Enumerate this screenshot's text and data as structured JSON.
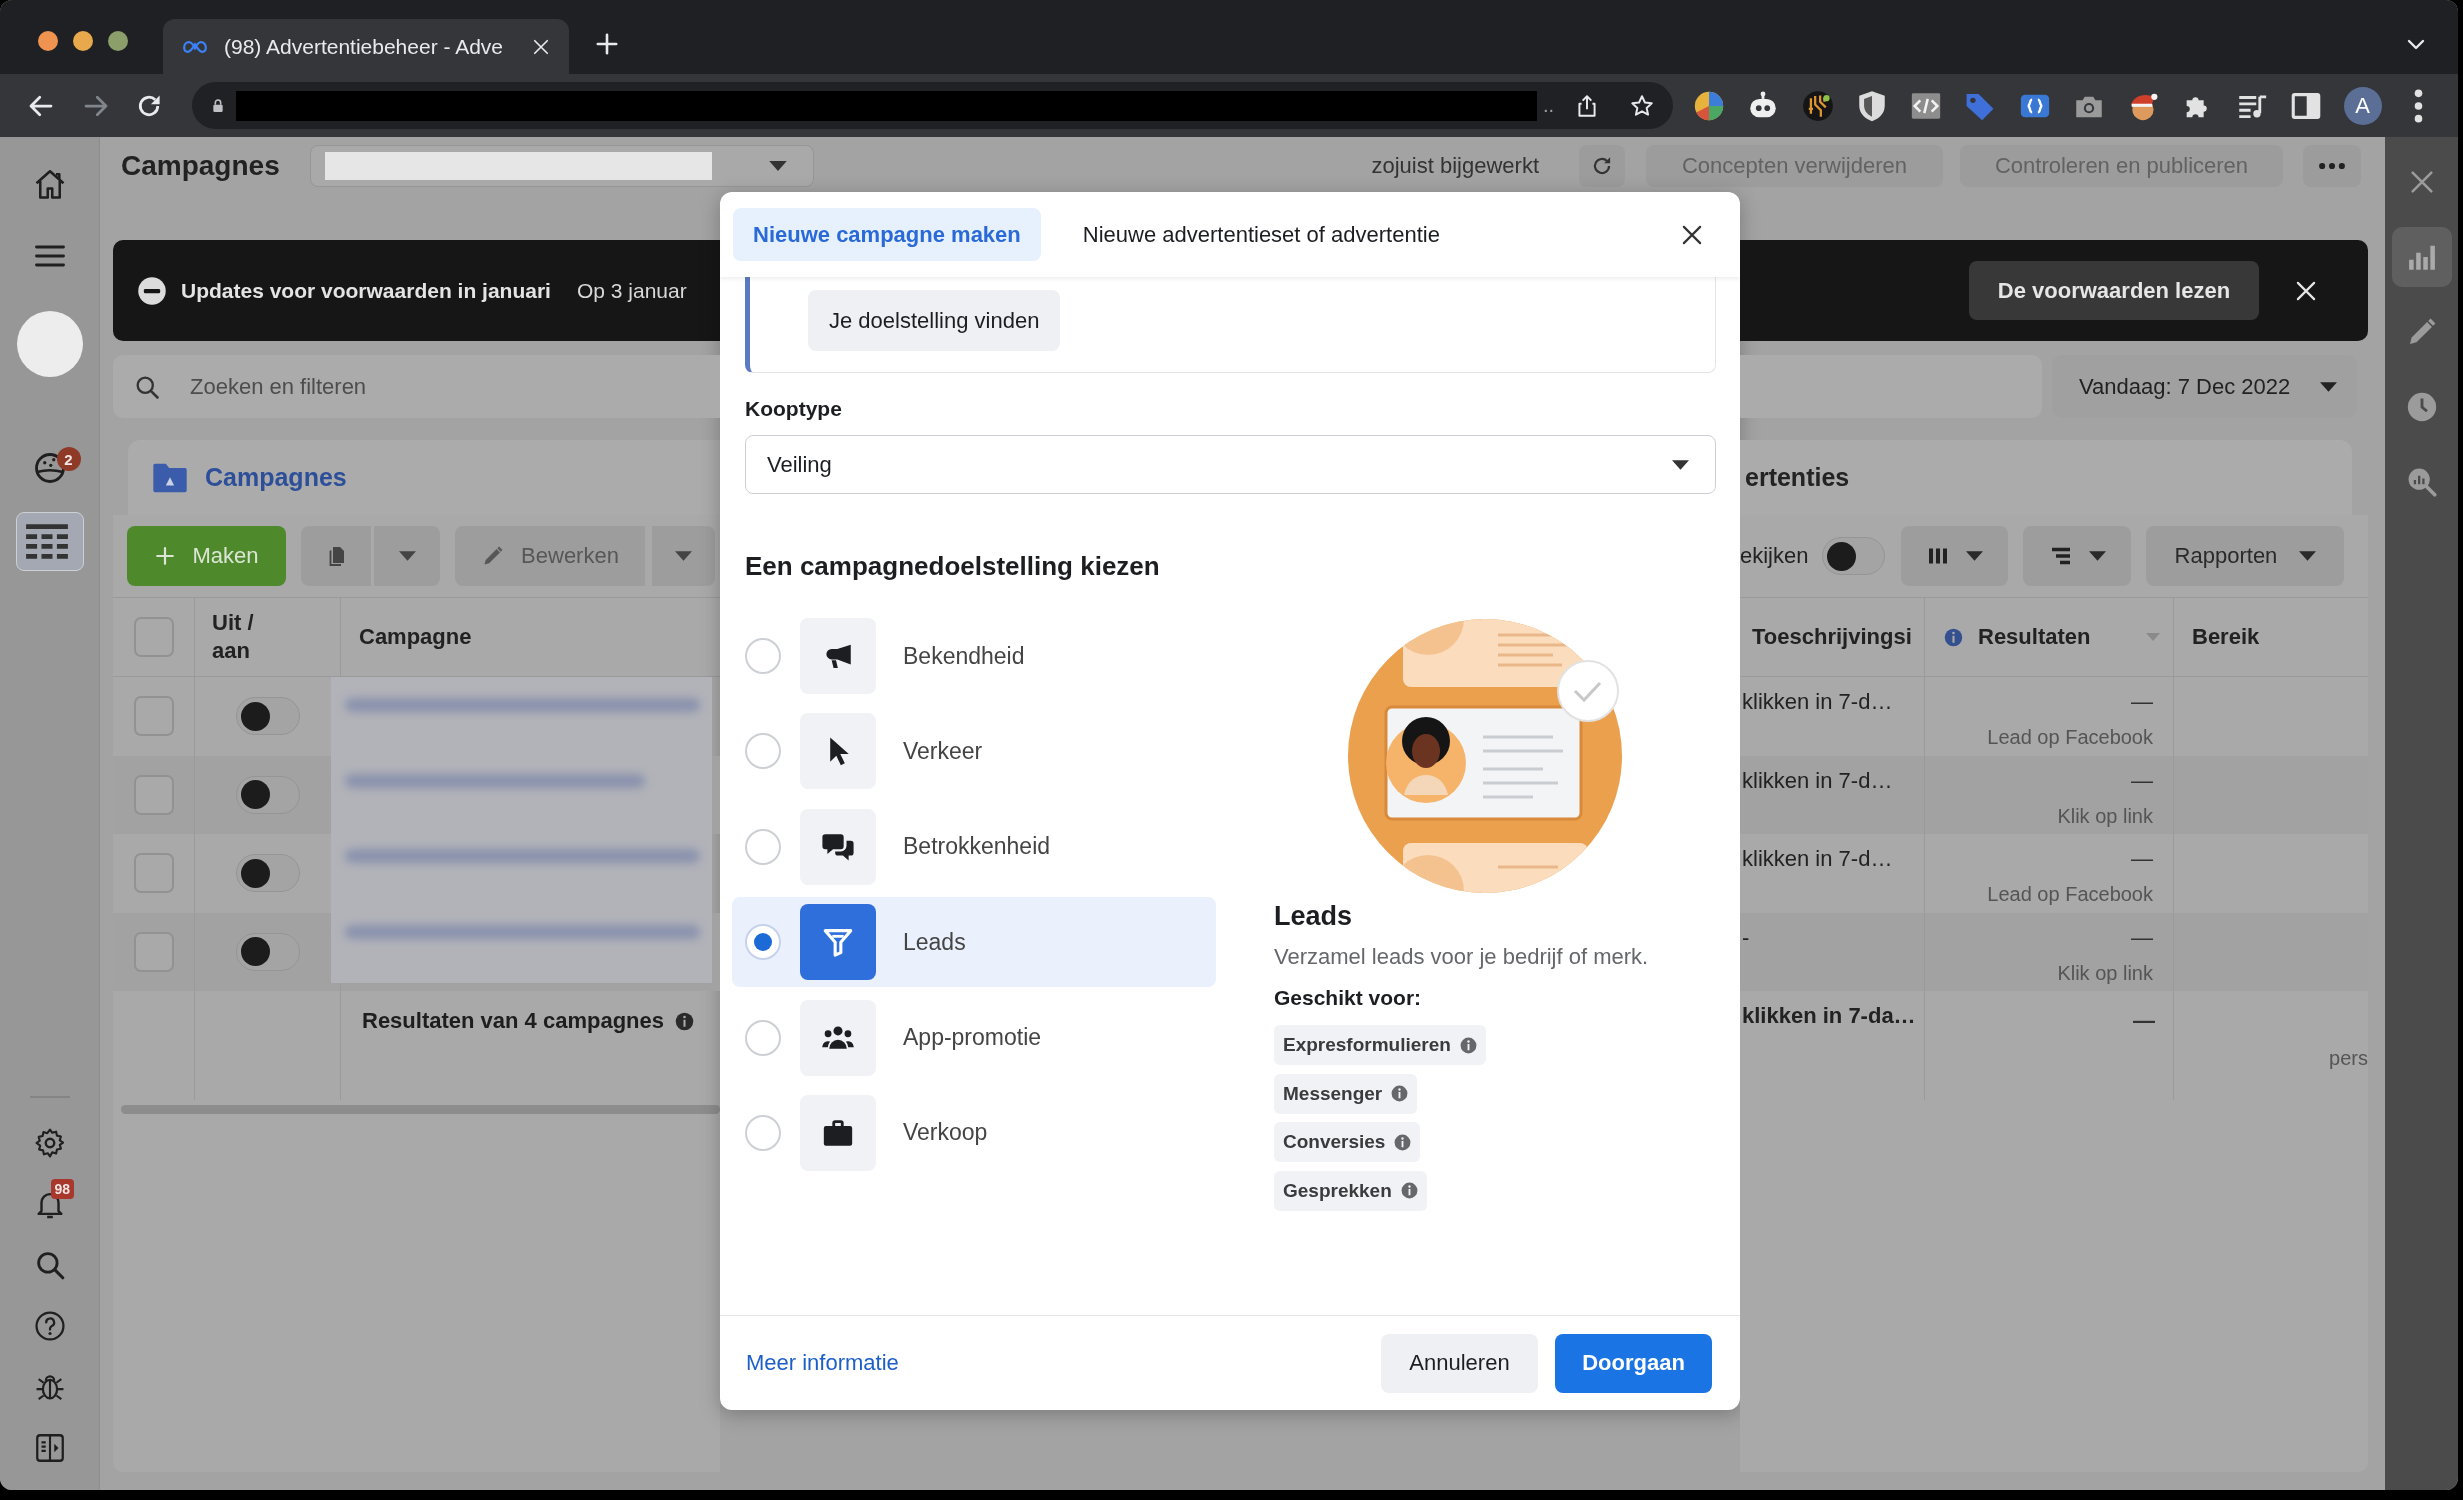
{
  "browser": {
    "tabs": [
      {
        "title": "(98) Advertentiebeheer - Adve",
        "selected": true
      }
    ],
    "url_tail": "..",
    "profile": "A"
  },
  "nav": {
    "items": [
      {
        "selected": false
      },
      {
        "selected": false
      },
      {
        "selected": false,
        "badge": "2"
      },
      {
        "selected": true
      }
    ],
    "bottom_items": [
      {
        "selected": false
      },
      {
        "selected": false,
        "badge": "98"
      },
      {
        "selected": false
      },
      {
        "selected": false
      },
      {
        "selected": false
      },
      {
        "selected": false
      }
    ]
  },
  "header": {
    "title": "Campagnes",
    "status": "zojuist bijgewerkt",
    "buttons": [
      {
        "label": "Concepten verwijderen",
        "disabled": true
      },
      {
        "label": "Controleren en publiceren",
        "disabled": true
      }
    ]
  },
  "notice": {
    "title": "Updates voor voorwaarden in januari",
    "text": "Op 3 januar",
    "button": "De voorwaarden lezen"
  },
  "filter": {
    "placeholder": "Zoeken en filteren",
    "date_range": "Vandaag: 7 Dec 2022"
  },
  "panel": {
    "tabs": [
      {
        "label": "Campagnes",
        "selected": true
      },
      {
        "label": "ertenties",
        "selected": false
      }
    ]
  },
  "toolbar": {
    "create": "Maken",
    "edit": {
      "label": "Bewerken",
      "disabled": true
    },
    "view_label": "ekijken",
    "view_on": false,
    "reports": "Rapporten"
  },
  "table": {
    "header_checked": false,
    "columns": [
      "Uit / aan",
      "Campagne",
      "Toeschrijvingsi",
      "Resultaten",
      "Bereik"
    ],
    "rows": [
      {
        "checked": false,
        "on": false,
        "attribution": "klikken in 7-d…",
        "result": "—",
        "result_type": "Lead op Facebook"
      },
      {
        "checked": false,
        "on": false,
        "attribution": "klikken in 7-d…",
        "result": "—",
        "result_type": "Klik op link"
      },
      {
        "checked": false,
        "on": false,
        "attribution": "klikken in 7-d…",
        "result": "—",
        "result_type": "Lead op Facebook"
      },
      {
        "checked": false,
        "on": false,
        "attribution": "-",
        "result": "—",
        "result_type": "Klik op link"
      }
    ],
    "summary": {
      "label": "Resultaten van 4 campagnes",
      "attribution": "klikken in 7-da…",
      "result": "—",
      "reach": "pers"
    }
  },
  "side_panel": {
    "items": [
      {
        "selected": true
      },
      {
        "selected": false
      },
      {
        "selected": false
      },
      {
        "selected": false
      }
    ]
  },
  "modal": {
    "tabs": [
      {
        "label": "Nieuwe campagne maken",
        "selected": true
      },
      {
        "label": "Nieuwe advertentieset of advertentie",
        "selected": false
      }
    ],
    "find_button": "Je doelstelling vinden",
    "buy_type": {
      "label": "Kooptype",
      "value": "Veiling"
    },
    "objective_heading": "Een campagnedoelstelling kiezen",
    "objectives": [
      {
        "label": "Bekendheid",
        "selected": false
      },
      {
        "label": "Verkeer",
        "selected": false
      },
      {
        "label": "Betrokkenheid",
        "selected": false
      },
      {
        "label": "Leads",
        "selected": true
      },
      {
        "label": "App-promotie",
        "selected": false
      },
      {
        "label": "Verkoop",
        "selected": false
      }
    ],
    "detail": {
      "title": "Leads",
      "description": "Verzamel leads voor je bedrijf of merk.",
      "suited_label": "Geschikt voor:",
      "tags": [
        "Expresformulieren",
        "Messenger",
        "Conversies",
        "Gesprekken"
      ]
    },
    "footer": {
      "link": "Meer informatie",
      "cancel": "Annuleren",
      "continue": "Doorgaan"
    }
  }
}
